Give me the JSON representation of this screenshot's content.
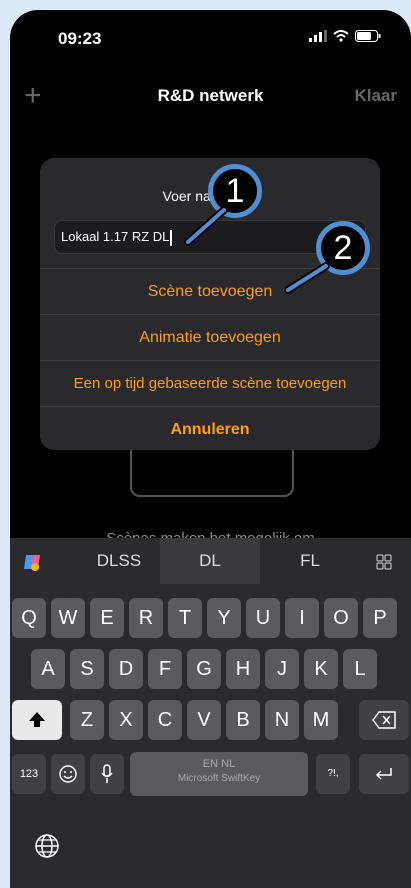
{
  "status": {
    "time": "09:23"
  },
  "nav": {
    "add_label": "+",
    "title": "R&D netwerk",
    "done_label": "Klaar"
  },
  "dialog": {
    "prompt": "Voer naam ...n:",
    "input_value": "Lokaal 1.17 RZ DL",
    "buttons": [
      "Scène toevoegen",
      "Animatie toevoegen",
      "Een op tijd gebaseerde scène toevoegen",
      "Annuleren"
    ]
  },
  "background": {
    "caption": "Scènes maken het mogelijk om"
  },
  "markers": [
    "1",
    "2"
  ],
  "keyboard": {
    "suggestions": [
      "DLSS",
      "DL",
      "FL"
    ],
    "row1": [
      "Q",
      "W",
      "E",
      "R",
      "T",
      "Y",
      "U",
      "I",
      "O",
      "P"
    ],
    "row2": [
      "A",
      "S",
      "D",
      "F",
      "G",
      "H",
      "J",
      "K",
      "L"
    ],
    "row3": [
      "Z",
      "X",
      "C",
      "V",
      "B",
      "N",
      "M"
    ],
    "numbers_label": "123",
    "space_lang": "EN NL",
    "space_brand": "Microsoft SwiftKey",
    "punct_label": "?!,"
  }
}
